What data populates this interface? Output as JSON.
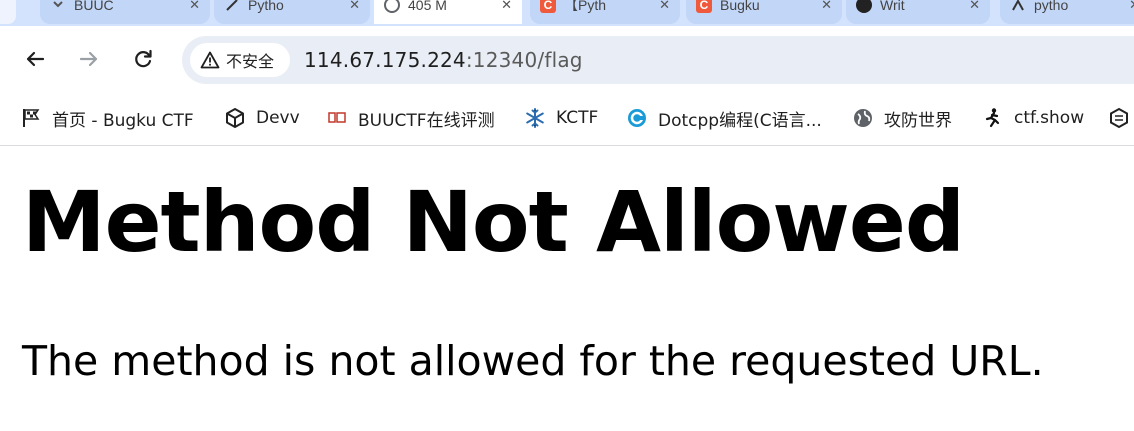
{
  "tabs": [
    {
      "label": "BUUC",
      "icon": "chevron-icon"
    },
    {
      "label": "Pytho",
      "icon": "quill-icon"
    },
    {
      "label": "405 M",
      "icon": "globe-icon"
    },
    {
      "label": "【Pyth",
      "icon": "csdn-icon"
    },
    {
      "label": "Bugku",
      "icon": "csdn-icon"
    },
    {
      "label": "Writ",
      "icon": "github-icon"
    },
    {
      "label": "pytho",
      "icon": "profile-icon"
    }
  ],
  "toolbar": {
    "security_label": "不安全",
    "url_host": "114.67.175.224",
    "url_rest": ":12340/flag"
  },
  "bookmarks": [
    {
      "label": "首页 - Bugku CTF",
      "icon": "flag-icon"
    },
    {
      "label": "Devv",
      "icon": "cube-icon"
    },
    {
      "label": "BUUCTF在线评测",
      "icon": "buuctf-logo-icon"
    },
    {
      "label": "KCTF",
      "icon": "snowflake-icon"
    },
    {
      "label": "Dotcpp编程(C语言...",
      "icon": "dotcpp-logo-icon"
    },
    {
      "label": "攻防世界",
      "icon": "globe-icon"
    },
    {
      "label": "ctf.show",
      "icon": "ctfshow-logo-icon"
    }
  ],
  "page": {
    "heading": "Method Not Allowed",
    "message": "The method is not allowed for the requested URL."
  },
  "colors": {
    "tabstrip": "#d3e3fd",
    "omnibox": "#e9eef6",
    "text": "#000000"
  }
}
